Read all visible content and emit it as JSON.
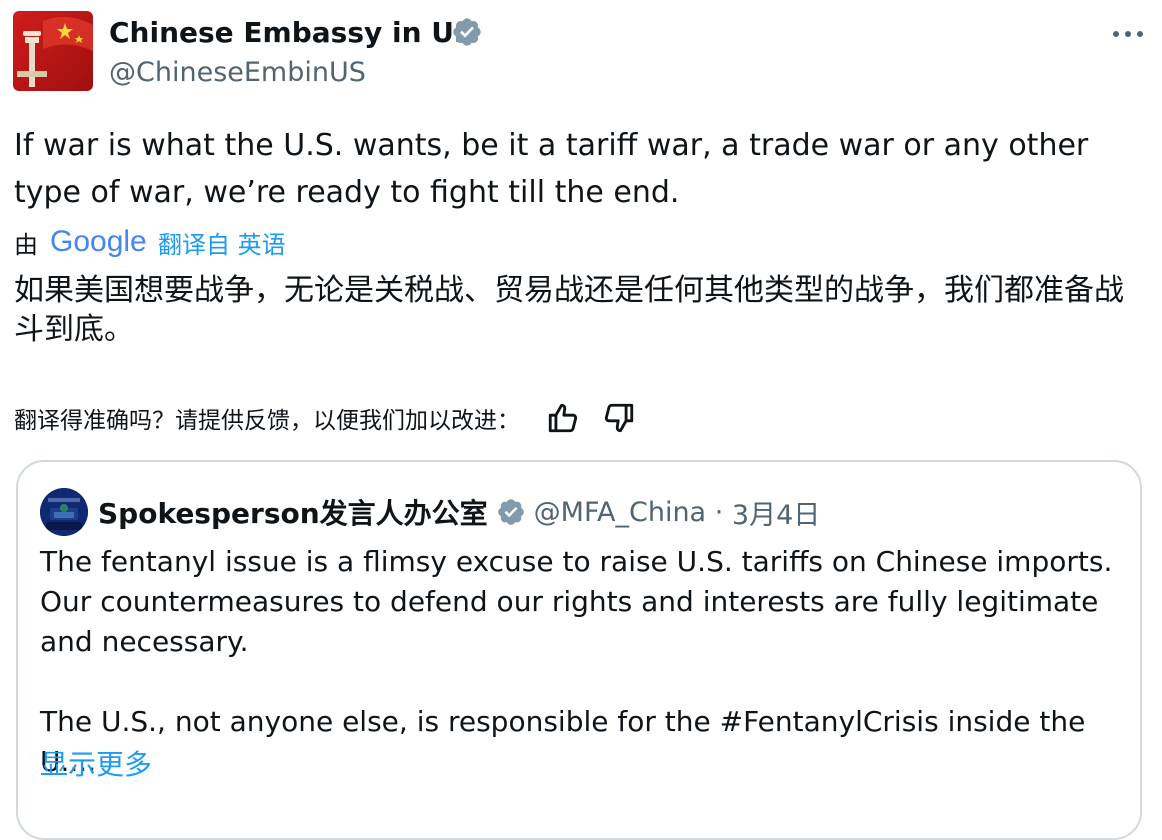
{
  "author": {
    "name": "Chinese Embassy in US",
    "handle": "@ChineseEmbinUS"
  },
  "tweet": {
    "text": "If war is what the U.S. wants, be it a tariff war, a trade war or any other type of war, we’re ready to fight till the end."
  },
  "translation": {
    "by_label": "由",
    "provider": "Google",
    "link": "翻译自 英语",
    "text": "如果美国想要战争，无论是关税战、贸易战还是任何其他类型的战争，我们都准备战斗到底。",
    "feedback_prompt": "翻译得准确吗？请提供反馈，以便我们加以改进："
  },
  "quote": {
    "name": "Spokesperson发言人办公室",
    "handle": "@MFA_China",
    "separator": "·",
    "date": "3月4日",
    "paragraph1": "The fentanyl issue is a flimsy excuse to raise U.S. tariffs on Chinese imports. Our countermeasures to defend our rights and interests are fully legitimate and necessary.",
    "paragraph2": "The U.S., not anyone else, is responsible for the #FentanylCrisis inside the U....",
    "show_more": "显示更多"
  },
  "icons": {
    "verified": "verified-badge-icon",
    "more": "more-horizontal-icon",
    "thumbs_up": "thumbs-up-icon",
    "thumbs_down": "thumbs-down-icon"
  },
  "colors": {
    "link": "#1d9bf0",
    "secondary_text": "#536471",
    "border": "#cfd9de",
    "badge": "#829aab"
  }
}
